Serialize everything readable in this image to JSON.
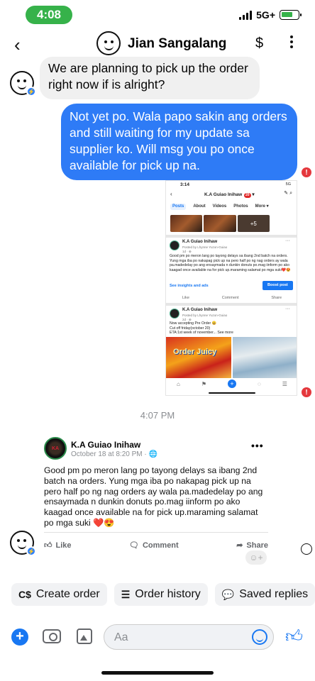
{
  "status_bar": {
    "time": "4:08",
    "network": "5G+"
  },
  "header": {
    "contact_name": "Jian Sangalang",
    "back_icon": "chevron-left-icon",
    "payment_icon": "dollar-icon",
    "more_icon": "more-vertical-icon"
  },
  "messages": {
    "incoming": "We are planning to pick up the order right now if is alright?",
    "outgoing": "Not yet po. Wala papo sakin ang orders and still waiting for my update sa supplier ko. Will msg you po once available for pick up na.",
    "error_glyph": "!"
  },
  "screenshot": {
    "status_time": "3:14",
    "status_right": "5G",
    "page_title": "K.A Guiao Inihaw",
    "badge": "20",
    "tabs": [
      "Posts",
      "About",
      "Videos",
      "Photos",
      "More ▾"
    ],
    "photos_more": "+5",
    "post1": {
      "name": "K.A Guiao Inihaw",
      "meta": "Posted by Lhynne Yuzon-Guiao",
      "meta2": "1d · ⊕",
      "text": "Good pm po meron lang po tayong delays sa ibang 2nd batch na orders. Yung mga iba po nakapag pick up na pero half po ng nag orders ay wala pa.madedelay po ang ensaymada n dunkin donuts po.mag iinform po ako kaagad once available na for pick up.maraming salamat po mga suki❤️😍",
      "insights": "See insights and ads",
      "boost": "Boost post",
      "like": "Like",
      "comment": "Comment",
      "share": "Share"
    },
    "post2": {
      "name": "K.A Guiao Inihaw",
      "meta": "Posted by Lhynne Yuzon-Guiao",
      "meta2": "2d · ⊕",
      "text": "Now accepting Pre Order 😀\nCut off friday(october 20)\nETA:1st week of november... See more",
      "image_text": "Order Juicy"
    }
  },
  "timestamp": "4:07 PM",
  "shared_post": {
    "page_name": "K.A Guiao Inihaw",
    "meta": "October 18 at 8:20 PM · 🌐",
    "text": "Good pm po meron lang po tayong delays sa ibang 2nd batch na orders. Yung mga iba po nakapag pick up na pero half po ng nag orders ay wala pa.madedelay po ang ensaymada n dunkin donuts po.mag iinform po ako kaagad once available na for pick up.maraming salamat po mga suki ❤️😍",
    "like": "Like",
    "comment": "Comment",
    "share": "Share"
  },
  "quick_actions": [
    {
      "icon": "C$",
      "label": "Create order"
    },
    {
      "icon": "☰",
      "label": "Order history"
    },
    {
      "icon": "💬",
      "label": "Saved replies"
    }
  ],
  "composer": {
    "placeholder": "Aa"
  },
  "colors": {
    "messenger_blue": "#2e7bf6",
    "status_green": "#36b24a",
    "error_red": "#e4383d"
  }
}
